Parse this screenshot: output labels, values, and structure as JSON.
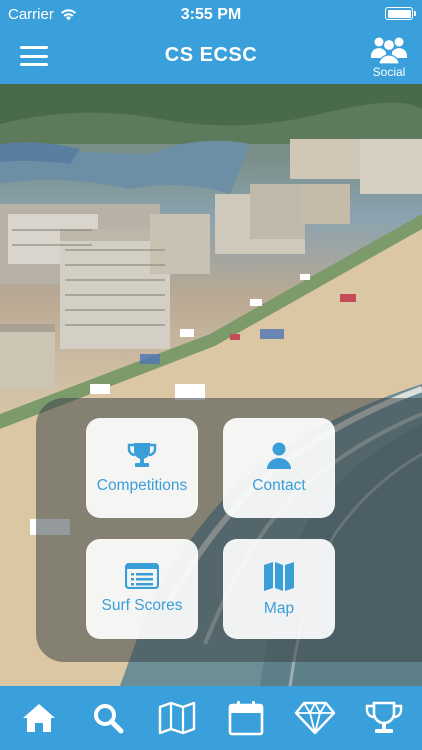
{
  "status_bar": {
    "carrier": "Carrier",
    "time": "3:55 PM",
    "wifi_icon": "wifi-icon",
    "battery_icon": "battery-icon"
  },
  "nav": {
    "title": "CS ECSC",
    "menu_icon": "hamburger-menu-icon",
    "social_label": "Social",
    "social_icon": "group-icon"
  },
  "hero": {
    "image_description_icon": "aerial-beach-photo"
  },
  "tiles": [
    {
      "label": "Competitions",
      "icon": "trophy-icon"
    },
    {
      "label": "Contact",
      "icon": "person-icon"
    },
    {
      "label": "Surf Scores",
      "icon": "scoreboard-icon"
    },
    {
      "label": "Map",
      "icon": "map-icon"
    }
  ],
  "tab_bar": {
    "items": [
      {
        "icon": "home-icon"
      },
      {
        "icon": "search-icon"
      },
      {
        "icon": "map-icon"
      },
      {
        "icon": "calendar-icon"
      },
      {
        "icon": "diamond-icon"
      },
      {
        "icon": "trophy-icon"
      }
    ]
  },
  "colors": {
    "brand_blue": "#3aa0db",
    "tile_background": "#ffffff",
    "tile_text": "#3a9ed8"
  }
}
